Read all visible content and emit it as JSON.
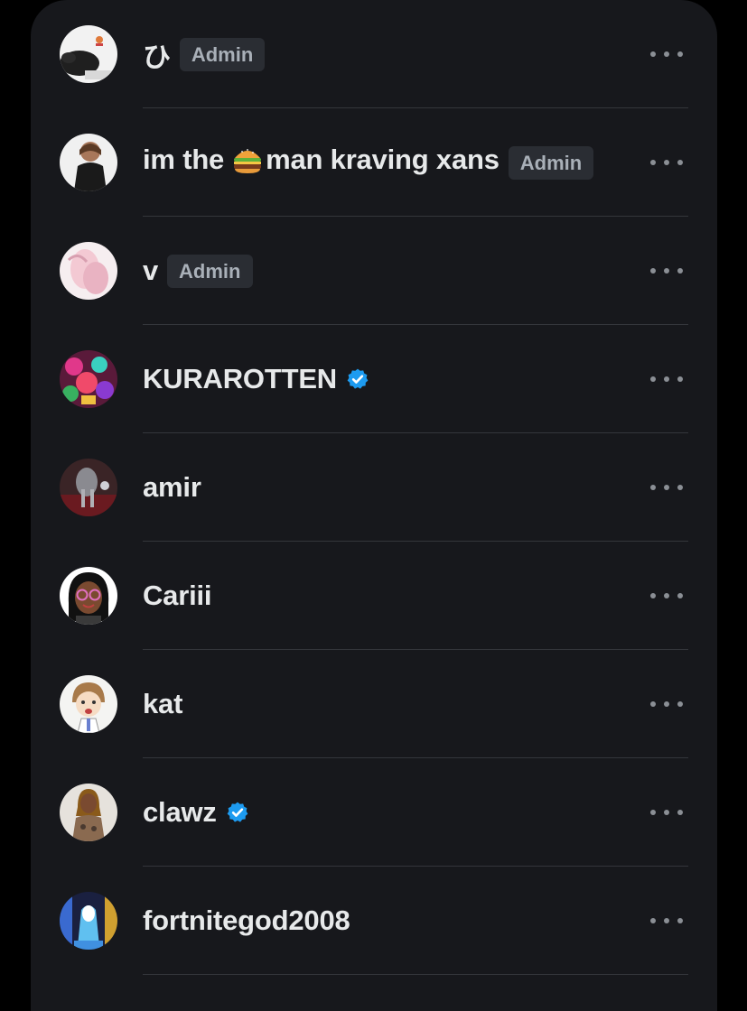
{
  "members": [
    {
      "name": "ひ",
      "badge": "Admin",
      "verified": false,
      "avatar": "avatar-dog-icon"
    },
    {
      "name_before": "im the",
      "name_after": "man kraving xans",
      "badge": "Admin",
      "verified": false,
      "avatar": "avatar-person-photo",
      "emoji": "hamburger-emoji"
    },
    {
      "name": "v",
      "badge": "Admin",
      "verified": false,
      "avatar": "avatar-pink-art"
    },
    {
      "name": "KURAROTTEN",
      "verified": true,
      "avatar": "avatar-colorful-art"
    },
    {
      "name": "amir",
      "verified": false,
      "avatar": "avatar-dark-art"
    },
    {
      "name": "Cariii",
      "verified": false,
      "avatar": "avatar-cartoon-glasses"
    },
    {
      "name": "kat",
      "verified": false,
      "avatar": "avatar-anime-boy"
    },
    {
      "name": "clawz",
      "verified": true,
      "avatar": "avatar-person-dreads"
    },
    {
      "name": "fortnitegod2008",
      "verified": false,
      "avatar": "avatar-blue-art"
    }
  ],
  "colors": {
    "background": "#17181c",
    "text": "#e7e9ea",
    "badge_bg": "#2a2d33",
    "badge_text": "#a9b0b8",
    "verified": "#1d9bf0",
    "divider": "#34363b"
  }
}
